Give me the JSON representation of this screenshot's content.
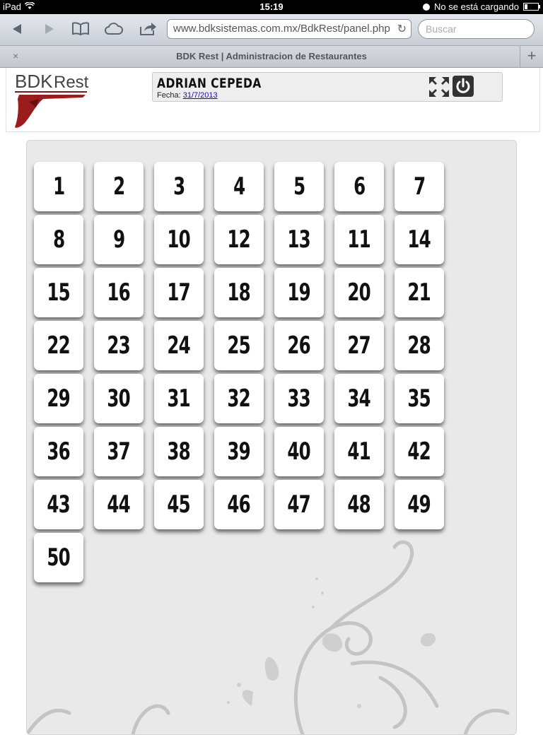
{
  "statusbar": {
    "device": "iPad",
    "time": "15:19",
    "charging": "No se está cargando"
  },
  "browser": {
    "url": "www.bdksistemas.com.mx/BdkRest/panel.php",
    "search_placeholder": "Buscar",
    "tab_title": "BDK Rest | Administracion de Restaurantes",
    "tab_close": "×",
    "tab_add": "+"
  },
  "header": {
    "logo_text": "BDK Rest",
    "user_name": "ADRIAN CEPEDA",
    "fecha_label": "Fecha:",
    "fecha_value": "31/7/2013"
  },
  "tables": [
    "1",
    "2",
    "3",
    "4",
    "5",
    "6",
    "7",
    "8",
    "9",
    "10",
    "12",
    "13",
    "11",
    "14",
    "15",
    "16",
    "17",
    "18",
    "19",
    "20",
    "21",
    "22",
    "23",
    "24",
    "25",
    "26",
    "27",
    "28",
    "29",
    "30",
    "31",
    "32",
    "33",
    "34",
    "35",
    "36",
    "37",
    "38",
    "39",
    "40",
    "41",
    "42",
    "43",
    "44",
    "45",
    "46",
    "47",
    "48",
    "49",
    "50"
  ],
  "colors": {
    "logo_red": "#9b1c1c",
    "panel_bg": "#e9e9e9"
  }
}
